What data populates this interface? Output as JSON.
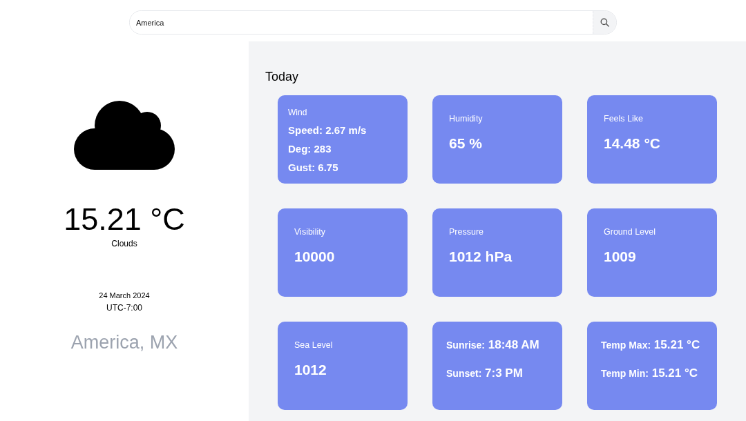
{
  "search": {
    "value": "America"
  },
  "current": {
    "temperature": "15.21 °C",
    "condition": "Clouds",
    "date": "24 March 2024",
    "timezone": "UTC-7:00",
    "location": "America, MX"
  },
  "section_title": "Today",
  "cards": [
    {
      "kind": "list",
      "title": "Wind",
      "lines": [
        "Speed: 2.67 m/s",
        "Deg: 283",
        "Gust: 6.75"
      ]
    },
    {
      "kind": "stat",
      "title": "Humidity",
      "value": "65 %"
    },
    {
      "kind": "stat",
      "title": "Feels Like",
      "value": "14.48 °C"
    },
    {
      "kind": "stat",
      "title": "Visibility",
      "value": "10000"
    },
    {
      "kind": "stat",
      "title": "Pressure",
      "value": "1012 hPa"
    },
    {
      "kind": "stat",
      "title": "Ground Level",
      "value": "1009"
    },
    {
      "kind": "stat",
      "title": "Sea Level",
      "value": "1012"
    },
    {
      "kind": "pairs",
      "pairs": [
        {
          "label": "Sunrise:",
          "value": "18:48 AM"
        },
        {
          "label": "Sunset:",
          "value": "7:3 PM"
        }
      ]
    },
    {
      "kind": "pairs",
      "pairs": [
        {
          "label": "Temp Max:",
          "value": "15.21 °C"
        },
        {
          "label": "Temp Min:",
          "value": "15.21 °C"
        }
      ]
    }
  ]
}
